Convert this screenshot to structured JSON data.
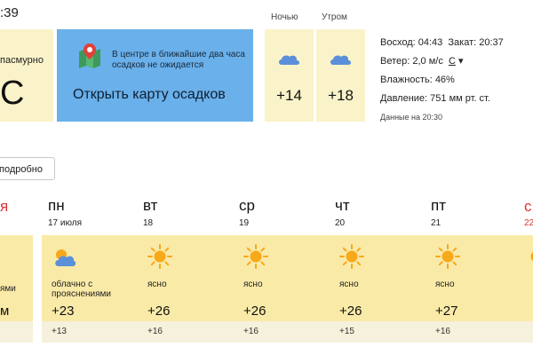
{
  "header": {
    "time": ":39"
  },
  "now": {
    "condition": "пасмурно",
    "temp": "С"
  },
  "map_card": {
    "message": "В центре в ближайшие два часа осадков не ожидается",
    "link": "Открыть карту осадков"
  },
  "periods": [
    {
      "label": "Ночью",
      "temp": "+14",
      "icon": "cloud-icon"
    },
    {
      "label": "Утром",
      "temp": "+18",
      "icon": "cloud-icon"
    }
  ],
  "details": {
    "sunrise_label": "Восход:",
    "sunrise": "04:43",
    "sunset_label": "Закат:",
    "sunset": "20:37",
    "wind_label": "Ветер:",
    "wind": "2,0 м/с",
    "wind_dir": "С",
    "humidity_label": "Влажность:",
    "humidity": "46%",
    "pressure_label": "Давление:",
    "pressure": "751 мм рт. ст.",
    "updated": "Данные на 20:30"
  },
  "more_button": "подробно",
  "partial_left": {
    "day_fragment": "я",
    "cond_fragment": "ями",
    "hi_fragment": "м"
  },
  "days": [
    {
      "name": "пн",
      "date": "17 июля",
      "condition": "облачно с прояснениями",
      "hi": "+23",
      "lo": "+13",
      "icon": "partly-cloudy-icon"
    },
    {
      "name": "вт",
      "date": "18",
      "condition": "ясно",
      "hi": "+26",
      "lo": "+16",
      "icon": "sun-icon"
    },
    {
      "name": "ср",
      "date": "19",
      "condition": "ясно",
      "hi": "+26",
      "lo": "+16",
      "icon": "sun-icon"
    },
    {
      "name": "чт",
      "date": "20",
      "condition": "ясно",
      "hi": "+26",
      "lo": "+15",
      "icon": "sun-icon"
    },
    {
      "name": "пт",
      "date": "21",
      "condition": "ясно",
      "hi": "+27",
      "lo": "+16",
      "icon": "sun-icon"
    }
  ],
  "partial_right": {
    "day_fragment": "с",
    "date_fragment": "22"
  },
  "colors": {
    "card_yellow": "#faf3c9",
    "map_blue": "#6ab0ea",
    "forecast_strip": "#faeaa8",
    "weekend_red": "#dd3333",
    "sun": "#f7a81b",
    "cloud": "#5b8fd9"
  }
}
